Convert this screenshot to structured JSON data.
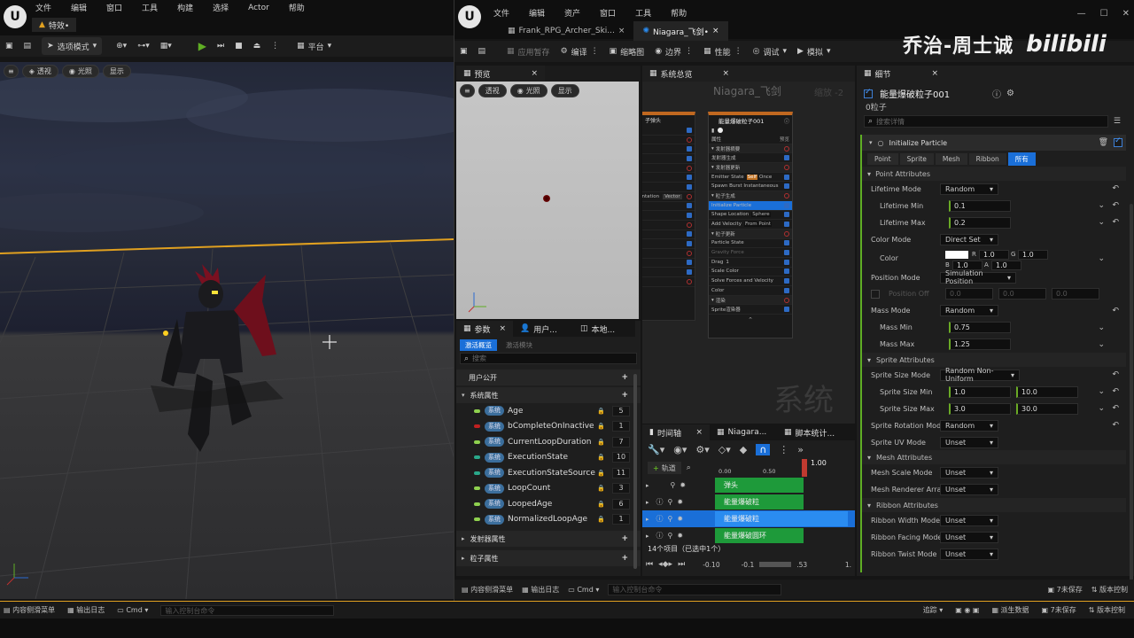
{
  "colors": {
    "accent_blue": "#2a8cf0",
    "ue_green": "#5fae24",
    "horizon": "#e0a020",
    "bg": "#151515"
  },
  "main": {
    "menu": [
      "文件",
      "编辑",
      "窗口",
      "工具",
      "构建",
      "选择",
      "Actor",
      "帮助"
    ],
    "level_tab": "特效•",
    "toolbar": {
      "mode": "选项模式",
      "platform": "平台"
    },
    "view_buttons": [
      "透视",
      "光照",
      "显示"
    ],
    "bottom": {
      "content_drawer": "内容侧滑菜单",
      "output_log": "输出日志",
      "cmd": "Cmd",
      "cmd_placeholder": "输入控制台命令"
    }
  },
  "niagara": {
    "menu": [
      "文件",
      "编辑",
      "资产",
      "窗口",
      "工具",
      "帮助"
    ],
    "tabs": [
      "Frank_RPG_Archer_Ski...",
      "Niagara_飞剑•"
    ],
    "toolbar": [
      "应用暂存",
      "编译",
      "缩略图",
      "边界",
      "性能",
      "调试",
      "模拟"
    ],
    "watermark": "乔治-周士诚",
    "watermark_logo": "bilibili",
    "preview": {
      "tab": "预览",
      "buttons": [
        "透视",
        "光照",
        "显示"
      ]
    },
    "overview": {
      "tab": "系统总览",
      "title": "Niagara_飞剑",
      "zoom": "缩放 -2",
      "label": "系统"
    },
    "node_left": {
      "title": "子弹头",
      "rows": [
        "",
        "",
        "",
        "",
        "",
        "",
        "",
        "Orientation",
        "",
        "",
        "",
        "",
        "",
        "",
        "",
        "",
        ""
      ],
      "badge": "Vector"
    },
    "node_right": {
      "title": "能量爆破粒子001",
      "rows": [
        "属性",
        "发射器摘要",
        "发射器生成",
        "发射器更新",
        "Emitter State",
        "Spawn Burst Instantaneous",
        "粒子生成",
        "Initialize Particle",
        "Shape Location",
        "Add Velocity",
        "粒子更新",
        "Particle State",
        "Gravity Force",
        "Drag",
        "Scale Color",
        "Solve Forces and Velocity",
        "Color",
        "渲染",
        "Sprite渲染器"
      ],
      "tags": {
        "emitter_state": "Self",
        "emitter_state2": "Once",
        "shape": "Sphere",
        "velocity": "From Point",
        "drag": "1"
      },
      "preview_label": "预览"
    },
    "params": {
      "tabs": [
        "参数",
        "用户...",
        "本地..."
      ],
      "subtabs": [
        "激活概览",
        "激活模块"
      ],
      "search_placeholder": "搜索",
      "user_exposed": "用户公开",
      "system_attrs": "系统属性",
      "items": [
        {
          "name": "Age",
          "count": "5",
          "color": "#8fd14f"
        },
        {
          "name": "bCompleteOnInactive",
          "count": "1",
          "color": "#c02020"
        },
        {
          "name": "CurrentLoopDuration",
          "count": "7",
          "color": "#8fd14f"
        },
        {
          "name": "ExecutionState",
          "count": "10",
          "color": "#2aa88a"
        },
        {
          "name": "ExecutionStateSource",
          "count": "11",
          "color": "#2aa88a"
        },
        {
          "name": "LoopCount",
          "count": "3",
          "color": "#8fd14f"
        },
        {
          "name": "LoopedAge",
          "count": "6",
          "color": "#8fd14f"
        },
        {
          "name": "NormalizedLoopAge",
          "count": "1",
          "color": "#8fd14f"
        }
      ],
      "tag": "系统",
      "emitter_attrs": "发射器属性",
      "particle_attrs": "粒子属性"
    },
    "timeline": {
      "tabs": [
        "时间轴",
        "Niagara...",
        "脚本统计..."
      ],
      "add_track": "轨道",
      "ticks": [
        "0.00",
        "0.50",
        "1.00"
      ],
      "current": "1.00",
      "tracks": [
        "弹头",
        "能量爆破粒",
        "能量爆破粒",
        "能量爆破圆环"
      ],
      "status": "14个项目（已选中1个）",
      "range_start": "-0.10",
      "range_mid": "-0.1",
      "range_end": ".53",
      "range_far": "1."
    },
    "details": {
      "tab": "细节",
      "title": "能量爆破粒子001",
      "subtitle": "0粒子",
      "search_placeholder": "搜索详情",
      "module": "Initialize Particle",
      "filter": [
        "Point",
        "Sprite",
        "Mesh",
        "Ribbon",
        "所有"
      ],
      "point_attrs": "Point Attributes",
      "lifetime_mode": {
        "label": "Lifetime Mode",
        "value": "Random"
      },
      "lifetime_min": {
        "label": "Lifetime Min",
        "value": "0.1"
      },
      "lifetime_max": {
        "label": "Lifetime Max",
        "value": "0.2"
      },
      "color_mode": {
        "label": "Color Mode",
        "value": "Direct Set"
      },
      "color": {
        "label": "Color",
        "r": "1.0",
        "g": "1.0",
        "b": "1.0",
        "a": "1.0"
      },
      "position_mode": {
        "label": "Position Mode",
        "value": "Simulation Position"
      },
      "position_offset": {
        "label": "Position Off",
        "x": "0.0",
        "y": "0.0",
        "z": "0.0"
      },
      "mass_mode": {
        "label": "Mass Mode",
        "value": "Random"
      },
      "mass_min": {
        "label": "Mass Min",
        "value": "0.75"
      },
      "mass_max": {
        "label": "Mass Max",
        "value": "1.25"
      },
      "sprite_attrs": "Sprite Attributes",
      "sprite_size_mode": {
        "label": "Sprite Size Mode",
        "value": "Random Non-Uniform"
      },
      "sprite_size_min": {
        "label": "Sprite Size Min",
        "x": "1.0",
        "y": "10.0"
      },
      "sprite_size_max": {
        "label": "Sprite Size Max",
        "x": "3.0",
        "y": "30.0"
      },
      "sprite_rot_mode": {
        "label": "Sprite Rotation Mod",
        "value": "Random"
      },
      "sprite_uv_mode": {
        "label": "Sprite UV Mode",
        "value": "Unset"
      },
      "mesh_attrs": "Mesh Attributes",
      "mesh_scale_mode": {
        "label": "Mesh Scale Mode",
        "value": "Unset"
      },
      "mesh_renderer": {
        "label": "Mesh Renderer Arra",
        "value": "Unset"
      },
      "ribbon_attrs": "Ribbon Attributes",
      "ribbon_width": {
        "label": "Ribbon Width Mode",
        "value": "Unset"
      },
      "ribbon_facing": {
        "label": "Ribbon Facing Mode",
        "value": "Unset"
      },
      "ribbon_twist": {
        "label": "Ribbon Twist Mode",
        "value": "Unset"
      }
    },
    "bottom": {
      "content_drawer": "内容侧滑菜单",
      "output_log": "输出日志",
      "cmd": "Cmd",
      "cmd_placeholder": "输入控制台命令",
      "unsaved": "7未保存",
      "version": "版本控制"
    }
  },
  "statusbar": {
    "trace": "追踪",
    "derived": "派生数据",
    "unsaved": "7未保存",
    "version": "版本控制"
  }
}
